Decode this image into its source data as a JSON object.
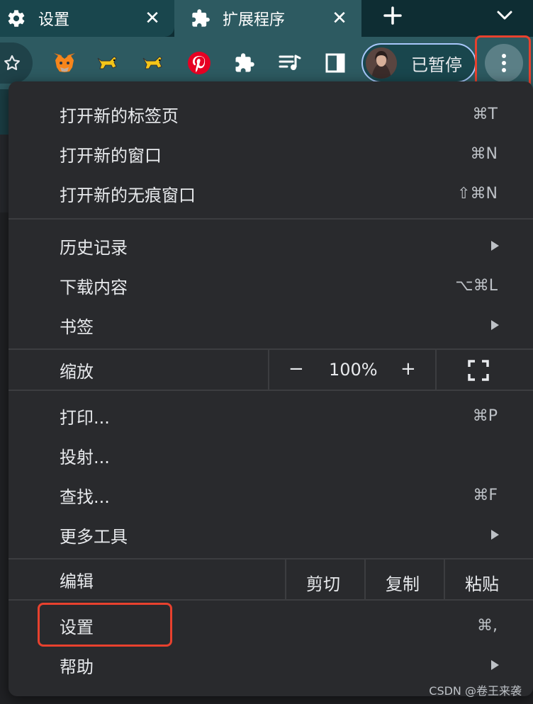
{
  "tabs": [
    {
      "title": "设置",
      "icon": "gear-icon",
      "close": "✕"
    },
    {
      "title": "扩展程序",
      "icon": "puzzle-icon",
      "close": "✕"
    }
  ],
  "tabstrip": {
    "new_tab_icon": "plus-icon",
    "tab_search_icon": "chevron-down-icon"
  },
  "toolbar": {
    "bookmark_star_icon": "star-outline-icon",
    "extensions": [
      "metamask-fox-icon",
      "tomcat-icon",
      "tomcat-icon",
      "pinterest-icon",
      "puzzle-icon",
      "media-queue-icon",
      "side-panel-icon"
    ],
    "profile": {
      "label": "已暂停",
      "avatar": "avatar"
    },
    "menu_icon": "kebab-menu-icon"
  },
  "menu": {
    "new_tab": {
      "label": "打开新的标签页",
      "shortcut": "⌘T"
    },
    "new_window": {
      "label": "打开新的窗口",
      "shortcut": "⌘N"
    },
    "new_incognito": {
      "label": "打开新的无痕窗口",
      "shortcut": "⇧⌘N"
    },
    "history": {
      "label": "历史记录"
    },
    "downloads": {
      "label": "下载内容",
      "shortcut": "⌥⌘L"
    },
    "bookmarks": {
      "label": "书签"
    },
    "zoom": {
      "label": "缩放",
      "minus": "−",
      "value": "100%",
      "plus": "+",
      "fullscreen_icon": "fullscreen-icon"
    },
    "print": {
      "label": "打印...",
      "shortcut": "⌘P"
    },
    "cast": {
      "label": "投射..."
    },
    "find": {
      "label": "查找...",
      "shortcut": "⌘F"
    },
    "more_tools": {
      "label": "更多工具"
    },
    "edit": {
      "label": "编辑",
      "cut": "剪切",
      "copy": "复制",
      "paste": "粘贴"
    },
    "settings": {
      "label": "设置",
      "shortcut": "⌘,"
    },
    "help": {
      "label": "帮助"
    }
  },
  "colors": {
    "highlight": "#e8412e",
    "menu_bg": "#292a2d",
    "toolbar_bg": "#2d5a61"
  },
  "watermark": "CSDN @卷王来袭"
}
